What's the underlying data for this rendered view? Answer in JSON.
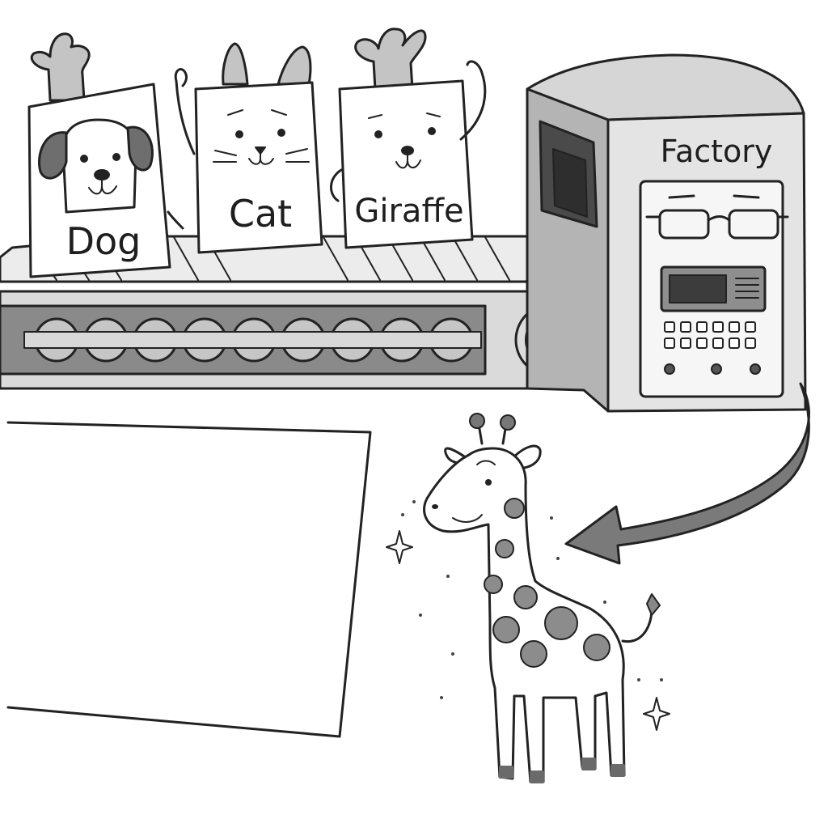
{
  "cards": [
    {
      "label": "Dog",
      "icon": "dog-face-icon"
    },
    {
      "label": "Cat",
      "icon": "cat-face-icon"
    },
    {
      "label": "Giraffe",
      "icon": "giraffe-face-icon"
    }
  ],
  "factory": {
    "label": "Factory"
  },
  "output": {
    "icon": "giraffe-icon"
  },
  "colors": {
    "ink": "#222222",
    "paper": "#ffffff",
    "light_gray": "#e4e4e4",
    "mid_gray": "#b8b8b8",
    "dark_gray": "#707070",
    "spot_gray": "#8c8c8c"
  }
}
